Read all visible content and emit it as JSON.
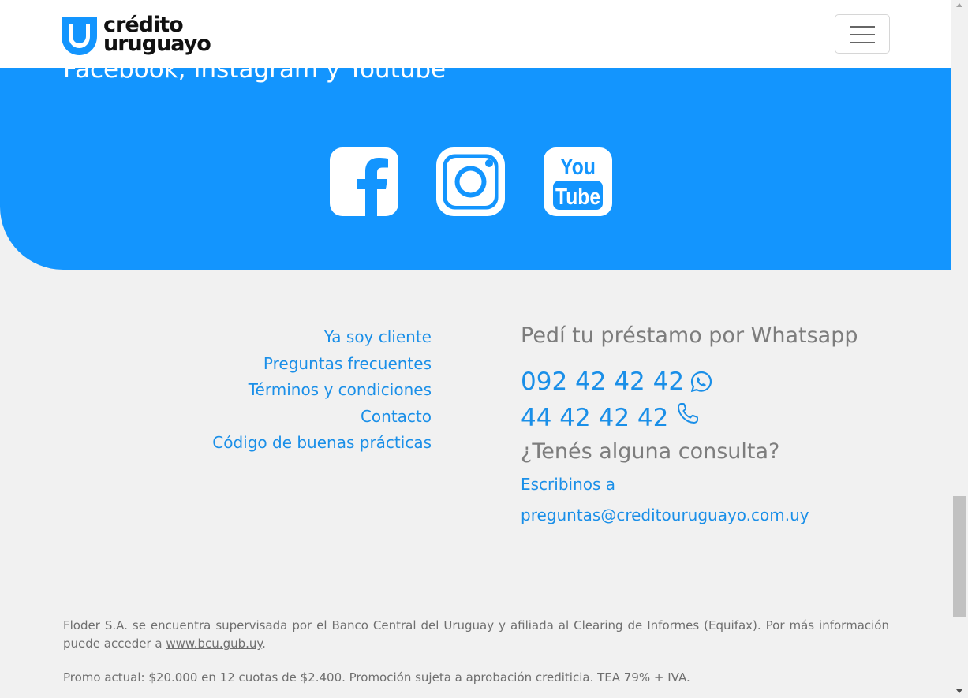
{
  "header": {
    "logo_line1": "crédito",
    "logo_line2": "uruguayo"
  },
  "social": {
    "heading": "Facebook, Instagram y Youtube",
    "icons": [
      "facebook-icon",
      "instagram-icon",
      "youtube-icon"
    ],
    "band_color": "#1395fe"
  },
  "links": [
    {
      "label": "Ya soy cliente"
    },
    {
      "label": "Preguntas frecuentes"
    },
    {
      "label": "Términos y condiciones"
    },
    {
      "label": "Contacto"
    },
    {
      "label": "Código de buenas prácticas"
    }
  ],
  "contact": {
    "whatsapp_title": "Pedí tu préstamo por Whatsapp",
    "whatsapp_number": "092 42 42 42",
    "phone_number": "44 42 42 42",
    "question_title": "¿Tenés alguna consulta?",
    "write_label": "Escribinos a",
    "email": "preguntas@creditouruguayo.com.uy"
  },
  "legal": {
    "text_before_link": "Floder S.A. se encuentra supervisada por el Banco Central del Uruguay y afiliada al Clearing de Informes (Equifax). Por más información puede acceder a ",
    "link": "www.bcu.gub.uy",
    "text_after_link": ".",
    "promo": "Promo actual: $20.000 en 12 cuotas de $2.400. Promoción sujeta a aprobación crediticia. TEA 79% + IVA."
  },
  "colors": {
    "accent": "#1a8fe8",
    "muted_text": "#7d7d7d"
  }
}
